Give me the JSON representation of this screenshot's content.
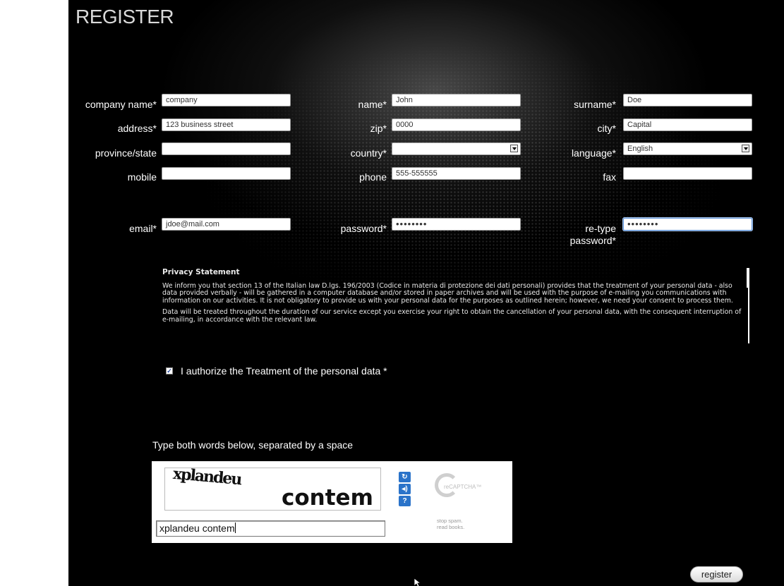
{
  "page": {
    "title": "REGISTER"
  },
  "form": {
    "company_name": {
      "label": "company name*",
      "value": "company"
    },
    "name": {
      "label": "name*",
      "value": "John"
    },
    "surname": {
      "label": "surname*",
      "value": "Doe"
    },
    "address": {
      "label": "address*",
      "value": "123 business street"
    },
    "zip": {
      "label": "zip*",
      "value": "0000"
    },
    "city": {
      "label": "city*",
      "value": "Capital"
    },
    "province": {
      "label": "province/state",
      "value": ""
    },
    "country": {
      "label": "country*",
      "value": ""
    },
    "language": {
      "label": "language*",
      "value": "English"
    },
    "mobile": {
      "label": "mobile",
      "value": ""
    },
    "phone": {
      "label": "phone",
      "value": "555-555555"
    },
    "fax": {
      "label": "fax",
      "value": ""
    },
    "email": {
      "label": "email*",
      "value": "jdoe@mail.com"
    },
    "password": {
      "label": "password*",
      "value": "••••••••"
    },
    "retype_password": {
      "label": "re-type password*",
      "value": "••••••••"
    }
  },
  "privacy": {
    "title": "Privacy Statement",
    "paragraph1": "We inform you that section 13 of the Italian law D.lgs. 196/2003 (Codice in materia di protezione dei dati personali) provides that the treatment of your personal data - also data provided verbally - will be gathered in a computer database and/or stored in paper archives and will be used with the purpose of e-mailing you communications with information on our activities. It is not obligatory to provide us with your personal data for the purposes as outlined herein; however, we need your consent to process them.",
    "paragraph2": "Data will be treated throughout the duration of our service except you exercise your right to obtain the cancellation of your personal data, with the consequent interruption of e-mailing, in accordance with the relevant law."
  },
  "consent": {
    "checked": true,
    "checkmark": "✓",
    "label": "I authorize the Treatment of the personal data *"
  },
  "captcha": {
    "instruction": "Type both words below, separated by a space",
    "word1": "xplandeu",
    "word2": "contem",
    "input_value": "xplandeu contem",
    "refresh_icon": "↻",
    "audio_icon": "◂)",
    "help_icon": "?",
    "brand": "reCAPTCHA™",
    "tagline1": "stop spam.",
    "tagline2": "read books."
  },
  "actions": {
    "register_label": "register"
  },
  "colors": {
    "background": "#000000",
    "text": "#ffffff",
    "captcha_button": "#2a73c9"
  }
}
